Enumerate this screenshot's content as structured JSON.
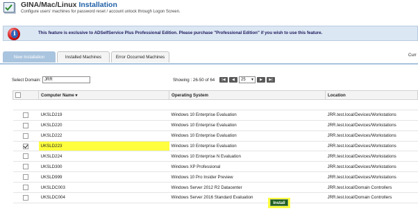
{
  "header": {
    "title_main": "GINA/Mac/Linux ",
    "title_accent": "Installation",
    "subtitle": "Configure users' machines for password reset / account unlock through Logon Screen.",
    "icon": "check-list-icon"
  },
  "banner": {
    "icon": "info-icon",
    "text": "This feature is exclusive to ADSelfService Plus Professional Edition. Please purchase \"Professional Edition\" if you wish to use this feature."
  },
  "tabs": [
    {
      "label": "New Installation",
      "active": true
    },
    {
      "label": "Installed Machines",
      "active": false
    },
    {
      "label": "Error Occurred Machines",
      "active": false
    }
  ],
  "tab_right_text": "Curr",
  "domain": {
    "label": "Select Domain:",
    "value": "JRR"
  },
  "pager": {
    "text": "Showing : 26-50 of 64",
    "page_size": "25",
    "first_icon": "first-page-icon",
    "prev_icon": "prev-page-icon",
    "next_icon": "next-page-icon",
    "last_icon": "last-page-icon"
  },
  "table": {
    "columns": [
      "Computer Name ▾",
      "Operating System",
      "Location"
    ],
    "rows": [
      {
        "name": "",
        "os": "",
        "location": "",
        "checked": false
      },
      {
        "name": "UKSLD219",
        "os": "Windows 10 Enterprise Evaluation",
        "location": "JRR.test.local/Devices/Workstations",
        "checked": false
      },
      {
        "name": "UKSLD220",
        "os": "Windows 10 Enterprise Evaluation",
        "location": "JRR.test.local/Devices/Workstations",
        "checked": false
      },
      {
        "name": "UKSLD222",
        "os": "Windows 10 Enterprise Evaluation",
        "location": "JRR.test.local/Devices/Workstations",
        "checked": false
      },
      {
        "name": "UKSLD223",
        "os": "Windows 10 Enterprise Evaluation",
        "location": "JRR.test.local/Devices/Workstations",
        "checked": true
      },
      {
        "name": "UKSLD224",
        "os": "Windows 10 Enterprise N Evaluation",
        "location": "JRR.test.local/Devices/Workstations",
        "checked": false
      },
      {
        "name": "UKSLD300",
        "os": "Windows XP Professional",
        "location": "JRR.test.local/Devices/Workstations",
        "checked": false
      },
      {
        "name": "UKSLD999",
        "os": "Windows 10 Pro Insider Preview",
        "location": "JRR.test.local/Devices/Workstations",
        "checked": false
      },
      {
        "name": "UKSLDC003",
        "os": "Windows Server 2012 R2 Datacenter",
        "location": "JRR.test.local/Domain Controllers",
        "checked": false
      },
      {
        "name": "UKSLDC004",
        "os": "Windows Server 2016 Standard Evaluation",
        "location": "JRR.test.local/Domain Controllers",
        "checked": false
      }
    ]
  },
  "install_button": "Install",
  "colors": {
    "accent": "#1f5fa6",
    "tab_active": "#a9c4de",
    "highlight": "#ffff3f",
    "install_bg": "#1e5e1e"
  }
}
